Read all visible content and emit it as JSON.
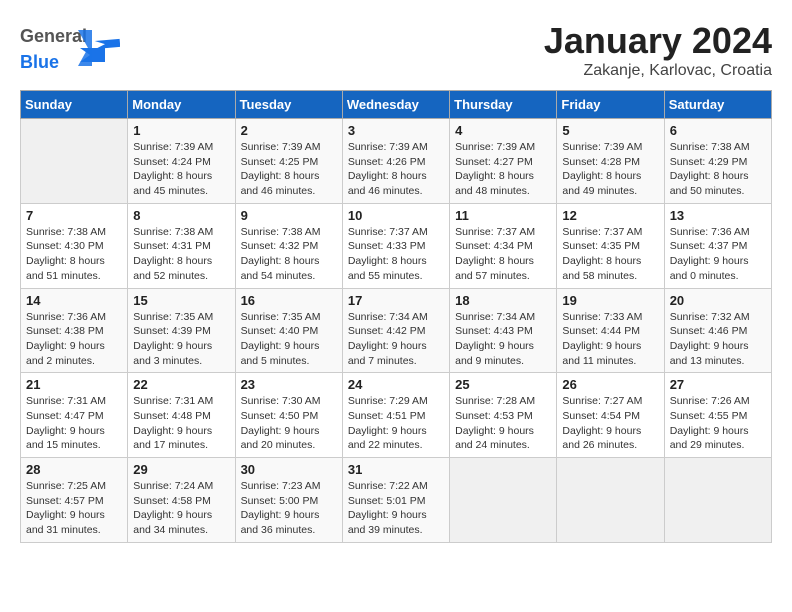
{
  "header": {
    "logo_general": "General",
    "logo_blue": "Blue",
    "title": "January 2024",
    "subtitle": "Zakanje, Karlovac, Croatia"
  },
  "days_of_week": [
    "Sunday",
    "Monday",
    "Tuesday",
    "Wednesday",
    "Thursday",
    "Friday",
    "Saturday"
  ],
  "weeks": [
    [
      {
        "day": "",
        "sunrise": "",
        "sunset": "",
        "daylight": ""
      },
      {
        "day": "1",
        "sunrise": "Sunrise: 7:39 AM",
        "sunset": "Sunset: 4:24 PM",
        "daylight": "Daylight: 8 hours and 45 minutes."
      },
      {
        "day": "2",
        "sunrise": "Sunrise: 7:39 AM",
        "sunset": "Sunset: 4:25 PM",
        "daylight": "Daylight: 8 hours and 46 minutes."
      },
      {
        "day": "3",
        "sunrise": "Sunrise: 7:39 AM",
        "sunset": "Sunset: 4:26 PM",
        "daylight": "Daylight: 8 hours and 46 minutes."
      },
      {
        "day": "4",
        "sunrise": "Sunrise: 7:39 AM",
        "sunset": "Sunset: 4:27 PM",
        "daylight": "Daylight: 8 hours and 48 minutes."
      },
      {
        "day": "5",
        "sunrise": "Sunrise: 7:39 AM",
        "sunset": "Sunset: 4:28 PM",
        "daylight": "Daylight: 8 hours and 49 minutes."
      },
      {
        "day": "6",
        "sunrise": "Sunrise: 7:38 AM",
        "sunset": "Sunset: 4:29 PM",
        "daylight": "Daylight: 8 hours and 50 minutes."
      }
    ],
    [
      {
        "day": "7",
        "sunrise": "Sunrise: 7:38 AM",
        "sunset": "Sunset: 4:30 PM",
        "daylight": "Daylight: 8 hours and 51 minutes."
      },
      {
        "day": "8",
        "sunrise": "Sunrise: 7:38 AM",
        "sunset": "Sunset: 4:31 PM",
        "daylight": "Daylight: 8 hours and 52 minutes."
      },
      {
        "day": "9",
        "sunrise": "Sunrise: 7:38 AM",
        "sunset": "Sunset: 4:32 PM",
        "daylight": "Daylight: 8 hours and 54 minutes."
      },
      {
        "day": "10",
        "sunrise": "Sunrise: 7:37 AM",
        "sunset": "Sunset: 4:33 PM",
        "daylight": "Daylight: 8 hours and 55 minutes."
      },
      {
        "day": "11",
        "sunrise": "Sunrise: 7:37 AM",
        "sunset": "Sunset: 4:34 PM",
        "daylight": "Daylight: 8 hours and 57 minutes."
      },
      {
        "day": "12",
        "sunrise": "Sunrise: 7:37 AM",
        "sunset": "Sunset: 4:35 PM",
        "daylight": "Daylight: 8 hours and 58 minutes."
      },
      {
        "day": "13",
        "sunrise": "Sunrise: 7:36 AM",
        "sunset": "Sunset: 4:37 PM",
        "daylight": "Daylight: 9 hours and 0 minutes."
      }
    ],
    [
      {
        "day": "14",
        "sunrise": "Sunrise: 7:36 AM",
        "sunset": "Sunset: 4:38 PM",
        "daylight": "Daylight: 9 hours and 2 minutes."
      },
      {
        "day": "15",
        "sunrise": "Sunrise: 7:35 AM",
        "sunset": "Sunset: 4:39 PM",
        "daylight": "Daylight: 9 hours and 3 minutes."
      },
      {
        "day": "16",
        "sunrise": "Sunrise: 7:35 AM",
        "sunset": "Sunset: 4:40 PM",
        "daylight": "Daylight: 9 hours and 5 minutes."
      },
      {
        "day": "17",
        "sunrise": "Sunrise: 7:34 AM",
        "sunset": "Sunset: 4:42 PM",
        "daylight": "Daylight: 9 hours and 7 minutes."
      },
      {
        "day": "18",
        "sunrise": "Sunrise: 7:34 AM",
        "sunset": "Sunset: 4:43 PM",
        "daylight": "Daylight: 9 hours and 9 minutes."
      },
      {
        "day": "19",
        "sunrise": "Sunrise: 7:33 AM",
        "sunset": "Sunset: 4:44 PM",
        "daylight": "Daylight: 9 hours and 11 minutes."
      },
      {
        "day": "20",
        "sunrise": "Sunrise: 7:32 AM",
        "sunset": "Sunset: 4:46 PM",
        "daylight": "Daylight: 9 hours and 13 minutes."
      }
    ],
    [
      {
        "day": "21",
        "sunrise": "Sunrise: 7:31 AM",
        "sunset": "Sunset: 4:47 PM",
        "daylight": "Daylight: 9 hours and 15 minutes."
      },
      {
        "day": "22",
        "sunrise": "Sunrise: 7:31 AM",
        "sunset": "Sunset: 4:48 PM",
        "daylight": "Daylight: 9 hours and 17 minutes."
      },
      {
        "day": "23",
        "sunrise": "Sunrise: 7:30 AM",
        "sunset": "Sunset: 4:50 PM",
        "daylight": "Daylight: 9 hours and 20 minutes."
      },
      {
        "day": "24",
        "sunrise": "Sunrise: 7:29 AM",
        "sunset": "Sunset: 4:51 PM",
        "daylight": "Daylight: 9 hours and 22 minutes."
      },
      {
        "day": "25",
        "sunrise": "Sunrise: 7:28 AM",
        "sunset": "Sunset: 4:53 PM",
        "daylight": "Daylight: 9 hours and 24 minutes."
      },
      {
        "day": "26",
        "sunrise": "Sunrise: 7:27 AM",
        "sunset": "Sunset: 4:54 PM",
        "daylight": "Daylight: 9 hours and 26 minutes."
      },
      {
        "day": "27",
        "sunrise": "Sunrise: 7:26 AM",
        "sunset": "Sunset: 4:55 PM",
        "daylight": "Daylight: 9 hours and 29 minutes."
      }
    ],
    [
      {
        "day": "28",
        "sunrise": "Sunrise: 7:25 AM",
        "sunset": "Sunset: 4:57 PM",
        "daylight": "Daylight: 9 hours and 31 minutes."
      },
      {
        "day": "29",
        "sunrise": "Sunrise: 7:24 AM",
        "sunset": "Sunset: 4:58 PM",
        "daylight": "Daylight: 9 hours and 34 minutes."
      },
      {
        "day": "30",
        "sunrise": "Sunrise: 7:23 AM",
        "sunset": "Sunset: 5:00 PM",
        "daylight": "Daylight: 9 hours and 36 minutes."
      },
      {
        "day": "31",
        "sunrise": "Sunrise: 7:22 AM",
        "sunset": "Sunset: 5:01 PM",
        "daylight": "Daylight: 9 hours and 39 minutes."
      },
      {
        "day": "",
        "sunrise": "",
        "sunset": "",
        "daylight": ""
      },
      {
        "day": "",
        "sunrise": "",
        "sunset": "",
        "daylight": ""
      },
      {
        "day": "",
        "sunrise": "",
        "sunset": "",
        "daylight": ""
      }
    ]
  ]
}
